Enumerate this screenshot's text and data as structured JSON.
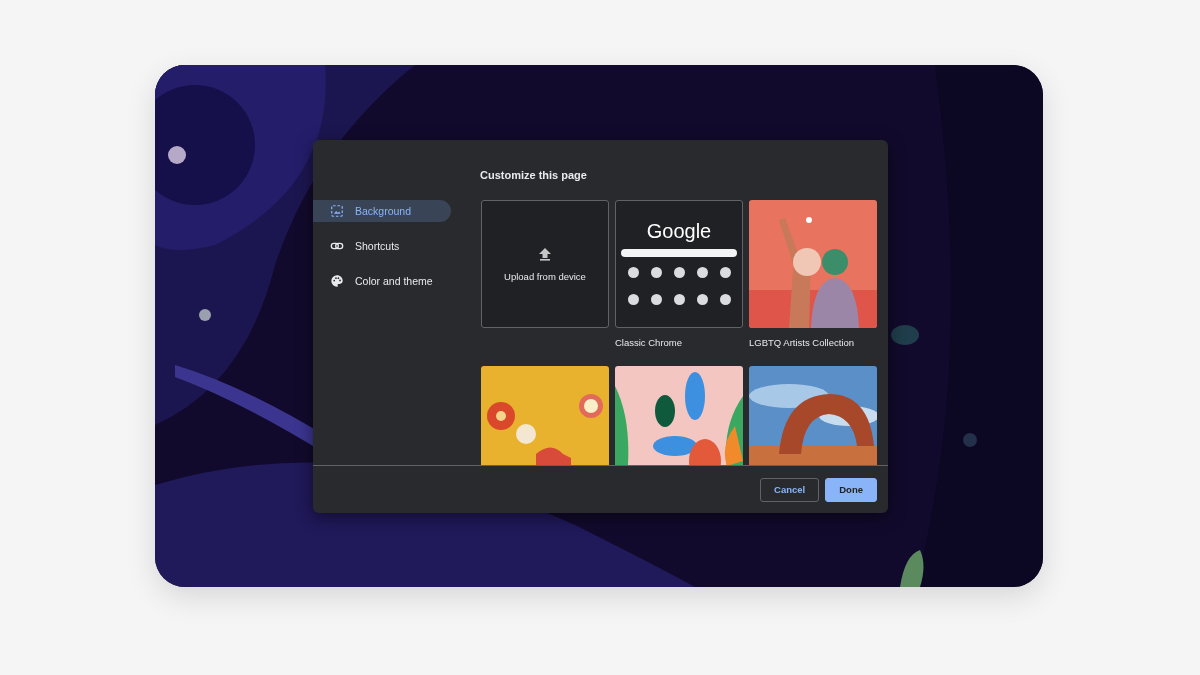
{
  "dialog": {
    "title": "Customize this page",
    "nav": [
      {
        "label": "Background",
        "selected": true
      },
      {
        "label": "Shortcuts",
        "selected": false
      },
      {
        "label": "Color and theme",
        "selected": false
      }
    ],
    "tiles": [
      {
        "kind": "upload",
        "label": "Upload from device"
      },
      {
        "kind": "classic",
        "logo": "Google",
        "caption": "Classic Chrome"
      },
      {
        "kind": "picture",
        "caption": "LGBTQ Artists Collection"
      },
      {
        "kind": "picture"
      },
      {
        "kind": "picture"
      },
      {
        "kind": "picture"
      }
    ],
    "buttons": [
      {
        "label": "Cancel",
        "kind": "secondary"
      },
      {
        "label": "Done",
        "kind": "primary"
      }
    ]
  }
}
